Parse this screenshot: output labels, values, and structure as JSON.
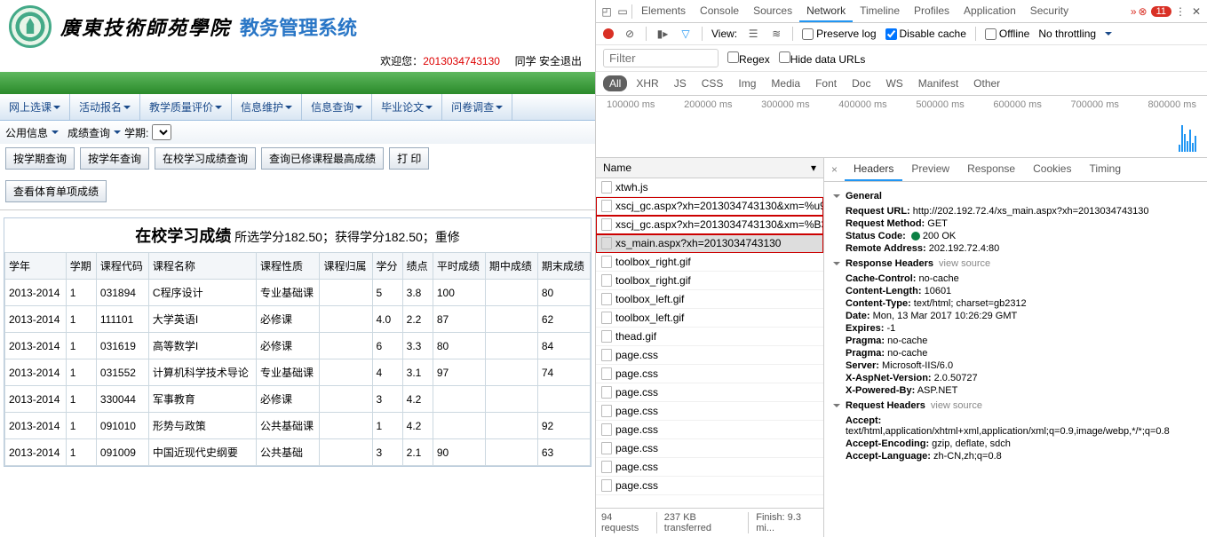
{
  "app": {
    "school_name": "廣東技術師苑學院",
    "system_name": "教务管理系统",
    "welcome_prefix": "欢迎您：",
    "user_id": "2013034743130",
    "user_suffix": "同学",
    "logout": "安全退出",
    "nav": [
      "网上选课",
      "活动报名",
      "教学质量评价",
      "信息维护",
      "信息查询",
      "毕业论文",
      "问卷调查"
    ],
    "subnav_left": "公用信息",
    "subnav_label": "成绩查询",
    "subnav_term": "学期:",
    "buttons": [
      "按学期查询",
      "按学年查询",
      "在校学习成绩查询",
      "查询已修课程最高成绩",
      "打 印"
    ],
    "button2": "查看体育单项成绩",
    "grades_title_main": "在校学习成绩",
    "grades_title_sub": "所选学分182.50；获得学分182.50；重修",
    "columns": [
      "学年",
      "学期",
      "课程代码",
      "课程名称",
      "课程性质",
      "课程归属",
      "学分",
      "绩点",
      "平时成绩",
      "期中成绩",
      "期末成绩"
    ],
    "rows": [
      {
        "year": "2013-2014",
        "term": "1",
        "code": "031894",
        "name": "C程序设计",
        "nature": "专业基础课",
        "belong": "",
        "credit": "5",
        "gpa": "3.8",
        "usual": "100",
        "mid": "",
        "final": "80"
      },
      {
        "year": "2013-2014",
        "term": "1",
        "code": "111101",
        "name": "大学英语I",
        "nature": "必修课",
        "belong": "",
        "credit": "4.0",
        "gpa": "2.2",
        "usual": "87",
        "mid": "",
        "final": "62"
      },
      {
        "year": "2013-2014",
        "term": "1",
        "code": "031619",
        "name": "高等数学I",
        "nature": "必修课",
        "belong": "",
        "credit": "6",
        "gpa": "3.3",
        "usual": "80",
        "mid": "",
        "final": "84"
      },
      {
        "year": "2013-2014",
        "term": "1",
        "code": "031552",
        "name": "计算机科学技术导论",
        "nature": "专业基础课",
        "belong": "",
        "credit": "4",
        "gpa": "3.1",
        "usual": "97",
        "mid": "",
        "final": "74"
      },
      {
        "year": "2013-2014",
        "term": "1",
        "code": "330044",
        "name": "军事教育",
        "nature": "必修课",
        "belong": "",
        "credit": "3",
        "gpa": "4.2",
        "usual": "",
        "mid": "",
        "final": ""
      },
      {
        "year": "2013-2014",
        "term": "1",
        "code": "091010",
        "name": "形势与政策",
        "nature": "公共基础课",
        "belong": "",
        "credit": "1",
        "gpa": "4.2",
        "usual": "",
        "mid": "",
        "final": "92"
      },
      {
        "year": "2013-2014",
        "term": "1",
        "code": "091009",
        "name": "中国近现代史纲要",
        "nature": "公共基础",
        "belong": "",
        "credit": "3",
        "gpa": "2.1",
        "usual": "90",
        "mid": "",
        "final": "63"
      }
    ]
  },
  "dev": {
    "top_tabs": [
      "Elements",
      "Console",
      "Sources",
      "Network",
      "Timeline",
      "Profiles",
      "Application",
      "Security"
    ],
    "active_top": "Network",
    "error_count": "11",
    "view_label": "View:",
    "preserve_log": "Preserve log",
    "disable_cache": "Disable cache",
    "offline": "Offline",
    "throttling": "No throttling",
    "filter_placeholder": "Filter",
    "regex": "Regex",
    "hide_data": "Hide data URLs",
    "type_pills": [
      "All",
      "XHR",
      "JS",
      "CSS",
      "Img",
      "Media",
      "Font",
      "Doc",
      "WS",
      "Manifest",
      "Other"
    ],
    "timeline_ticks": [
      "100000 ms",
      "200000 ms",
      "300000 ms",
      "400000 ms",
      "500000 ms",
      "600000 ms",
      "700000 ms",
      "800000 ms"
    ],
    "req_head": "Name",
    "requests": [
      {
        "name": "xtwh.js",
        "boxed": false,
        "sel": false
      },
      {
        "name": "xscj_gc.aspx?xh=2013034743130&xm=%u9",
        "boxed": true,
        "sel": false
      },
      {
        "name": "xscj_gc.aspx?xh=2013034743130&xm=%B3",
        "boxed": true,
        "sel": false
      },
      {
        "name": "xs_main.aspx?xh=2013034743130",
        "boxed": true,
        "sel": true
      },
      {
        "name": "toolbox_right.gif",
        "boxed": false,
        "sel": false
      },
      {
        "name": "toolbox_right.gif",
        "boxed": false,
        "sel": false
      },
      {
        "name": "toolbox_left.gif",
        "boxed": false,
        "sel": false
      },
      {
        "name": "toolbox_left.gif",
        "boxed": false,
        "sel": false
      },
      {
        "name": "thead.gif",
        "boxed": false,
        "sel": false
      },
      {
        "name": "page.css",
        "boxed": false,
        "sel": false
      },
      {
        "name": "page.css",
        "boxed": false,
        "sel": false
      },
      {
        "name": "page.css",
        "boxed": false,
        "sel": false
      },
      {
        "name": "page.css",
        "boxed": false,
        "sel": false
      },
      {
        "name": "page.css",
        "boxed": false,
        "sel": false
      },
      {
        "name": "page.css",
        "boxed": false,
        "sel": false
      },
      {
        "name": "page.css",
        "boxed": false,
        "sel": false
      },
      {
        "name": "page.css",
        "boxed": false,
        "sel": false
      }
    ],
    "status_bar": [
      "94 requests",
      "237 KB transferred",
      "Finish: 9.3 mi..."
    ],
    "detail_tabs": [
      "Headers",
      "Preview",
      "Response",
      "Cookies",
      "Timing"
    ],
    "sections": {
      "general": {
        "title": "General",
        "items": [
          {
            "k": "Request URL:",
            "v": "http://202.192.72.4/xs_main.aspx?xh=2013034743130"
          },
          {
            "k": "Request Method:",
            "v": "GET"
          },
          {
            "k": "Status Code:",
            "v": "200 OK",
            "dot": true
          },
          {
            "k": "Remote Address:",
            "v": "202.192.72.4:80"
          }
        ]
      },
      "response": {
        "title": "Response Headers",
        "vsrc": "view source",
        "items": [
          {
            "k": "Cache-Control:",
            "v": "no-cache"
          },
          {
            "k": "Content-Length:",
            "v": "10601"
          },
          {
            "k": "Content-Type:",
            "v": "text/html; charset=gb2312"
          },
          {
            "k": "Date:",
            "v": "Mon, 13 Mar 2017 10:26:29 GMT"
          },
          {
            "k": "Expires:",
            "v": "-1"
          },
          {
            "k": "Pragma:",
            "v": "no-cache"
          },
          {
            "k": "Pragma:",
            "v": "no-cache"
          },
          {
            "k": "Server:",
            "v": "Microsoft-IIS/6.0"
          },
          {
            "k": "X-AspNet-Version:",
            "v": "2.0.50727"
          },
          {
            "k": "X-Powered-By:",
            "v": "ASP.NET"
          }
        ]
      },
      "request": {
        "title": "Request Headers",
        "vsrc": "view source",
        "items": [
          {
            "k": "Accept:",
            "v": "text/html,application/xhtml+xml,application/xml;q=0.9,image/webp,*/*;q=0.8"
          },
          {
            "k": "Accept-Encoding:",
            "v": "gzip, deflate, sdch"
          },
          {
            "k": "Accept-Language:",
            "v": "zh-CN,zh;q=0.8"
          }
        ]
      }
    }
  }
}
